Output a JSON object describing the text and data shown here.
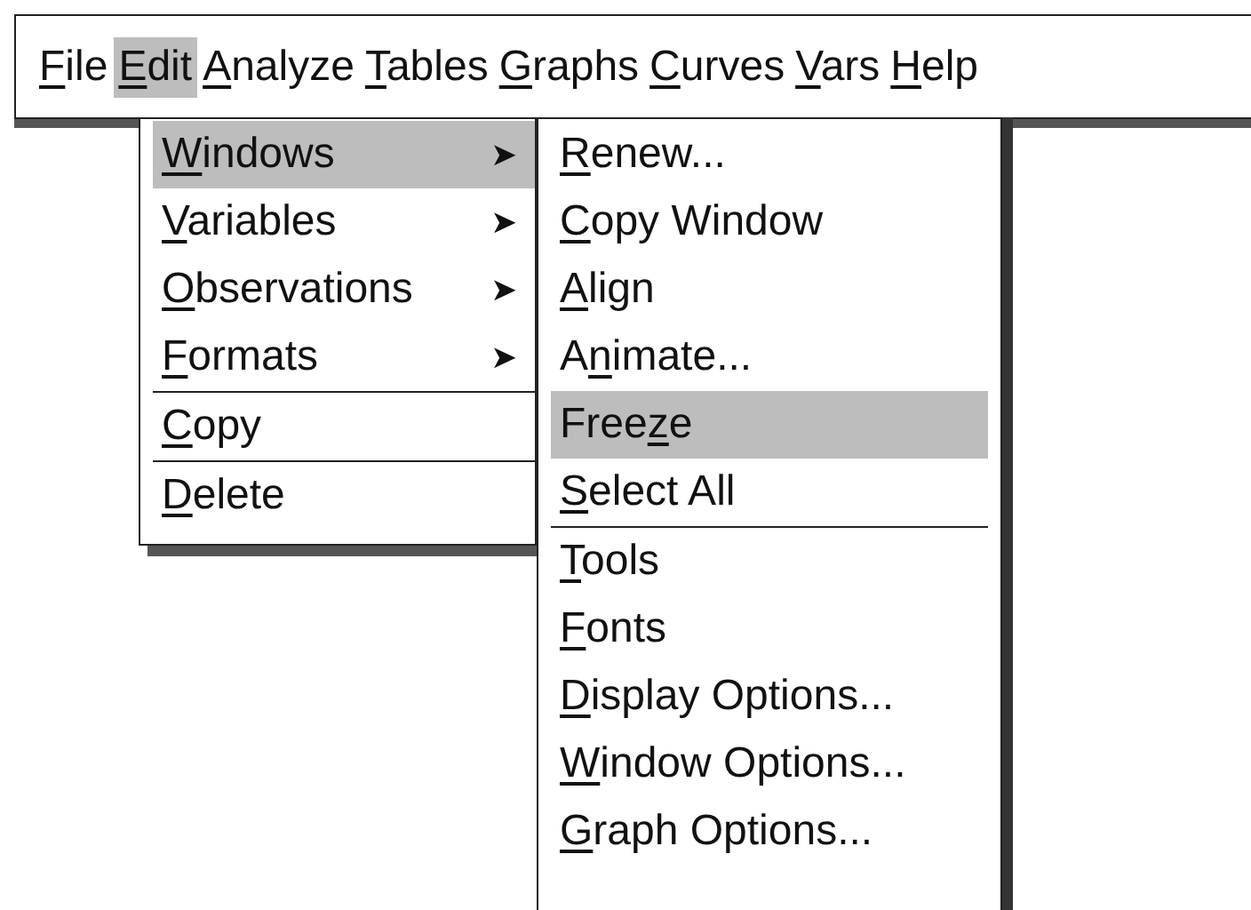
{
  "menu_bar": [
    {
      "label": [
        {
          "text": "F",
          "underlined": true
        },
        {
          "text": "ile",
          "underlined": false
        }
      ],
      "selected": false
    },
    {
      "label": [
        {
          "text": "E",
          "underlined": true
        },
        {
          "text": "dit",
          "underlined": false
        }
      ],
      "selected": true
    },
    {
      "label": [
        {
          "text": "A",
          "underlined": true
        },
        {
          "text": "nalyze",
          "underlined": false
        }
      ],
      "selected": false
    },
    {
      "label": [
        {
          "text": "T",
          "underlined": true
        },
        {
          "text": "ables",
          "underlined": false
        }
      ],
      "selected": false
    },
    {
      "label": [
        {
          "text": "G",
          "underlined": true
        },
        {
          "text": "raphs",
          "underlined": false
        }
      ],
      "selected": false
    },
    {
      "label": [
        {
          "text": "C",
          "underlined": true
        },
        {
          "text": "urves",
          "underlined": false
        }
      ],
      "selected": false
    },
    {
      "label": [
        {
          "text": "V",
          "underlined": true
        },
        {
          "text": "ars",
          "underlined": false
        }
      ],
      "selected": false
    },
    {
      "label": [
        {
          "text": "H",
          "underlined": true
        },
        {
          "text": "elp",
          "underlined": false
        }
      ],
      "selected": false
    }
  ],
  "edit_menu": [
    {
      "label": [
        {
          "text": "W",
          "underlined": true
        },
        {
          "text": "indows",
          "underlined": false
        }
      ],
      "selected": true,
      "submenu_arrow": "➤",
      "divider_above": false
    },
    {
      "label": [
        {
          "text": "V",
          "underlined": true
        },
        {
          "text": "ariables",
          "underlined": false
        }
      ],
      "selected": false,
      "submenu_arrow": "➤",
      "divider_above": false
    },
    {
      "label": [
        {
          "text": "O",
          "underlined": true
        },
        {
          "text": "bservations",
          "underlined": false
        }
      ],
      "selected": false,
      "submenu_arrow": "➤",
      "divider_above": false
    },
    {
      "label": [
        {
          "text": "F",
          "underlined": true
        },
        {
          "text": "ormats",
          "underlined": false
        }
      ],
      "selected": false,
      "submenu_arrow": "➤",
      "divider_above": false
    },
    {
      "label": [
        {
          "text": "C",
          "underlined": true
        },
        {
          "text": "opy",
          "underlined": false
        }
      ],
      "selected": false,
      "divider_above": true
    },
    {
      "label": [
        {
          "text": "D",
          "underlined": true
        },
        {
          "text": "elete",
          "underlined": false
        }
      ],
      "selected": false,
      "divider_above": true
    }
  ],
  "windows_menu": [
    {
      "label": [
        {
          "text": "R",
          "underlined": true
        },
        {
          "text": "enew...",
          "underlined": false
        }
      ],
      "selected": false,
      "divider_above": false
    },
    {
      "label": [
        {
          "text": "C",
          "underlined": true
        },
        {
          "text": "opy Window",
          "underlined": false
        }
      ],
      "selected": false,
      "divider_above": false
    },
    {
      "label": [
        {
          "text": "A",
          "underlined": true
        },
        {
          "text": "lign",
          "underlined": false
        }
      ],
      "selected": false,
      "divider_above": false
    },
    {
      "label": [
        {
          "text": "A",
          "underlined": false
        },
        {
          "text": "n",
          "underlined": true
        },
        {
          "text": "imate...",
          "underlined": false
        }
      ],
      "selected": false,
      "divider_above": false
    },
    {
      "label": [
        {
          "text": "Free",
          "underlined": false
        },
        {
          "text": "z",
          "underlined": true
        },
        {
          "text": "e",
          "underlined": false
        }
      ],
      "selected": true,
      "divider_above": false
    },
    {
      "label": [
        {
          "text": "S",
          "underlined": true
        },
        {
          "text": "elect All",
          "underlined": false
        }
      ],
      "selected": false,
      "divider_above": false
    },
    {
      "label": [
        {
          "text": "T",
          "underlined": true
        },
        {
          "text": "ools",
          "underlined": false
        }
      ],
      "selected": false,
      "divider_above": true
    },
    {
      "label": [
        {
          "text": "F",
          "underlined": true
        },
        {
          "text": "onts",
          "underlined": false
        }
      ],
      "selected": false,
      "divider_above": false
    },
    {
      "label": [
        {
          "text": "D",
          "underlined": true
        },
        {
          "text": "isplay Options...",
          "underlined": false
        }
      ],
      "selected": false,
      "divider_above": false
    },
    {
      "label": [
        {
          "text": "W",
          "underlined": true
        },
        {
          "text": "indow Options...",
          "underlined": false
        }
      ],
      "selected": false,
      "divider_above": false
    },
    {
      "label": [
        {
          "text": "G",
          "underlined": true
        },
        {
          "text": "raph Options...",
          "underlined": false
        }
      ],
      "selected": false,
      "divider_above": false
    }
  ]
}
